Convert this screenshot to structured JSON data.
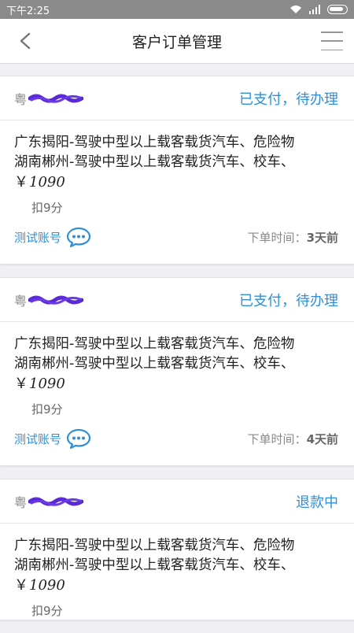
{
  "status_bar": {
    "time": "下午2:25"
  },
  "nav": {
    "title": "客户订单管理"
  },
  "orders": [
    {
      "plate": "粤",
      "status": "已支付，待办理",
      "route_1": "广东揭阳-驾驶中型以上载客载货汽车、危险物",
      "route_2": "湖南郴州-驾驶中型以上载客载货汽车、校车、",
      "currency": "￥",
      "price": "1090",
      "points": "扣9分",
      "account": "测试账号",
      "time_label": "下单时间：",
      "time_value": "3天前"
    },
    {
      "plate": "粤",
      "status": "已支付，待办理",
      "route_1": "广东揭阳-驾驶中型以上载客载货汽车、危险物",
      "route_2": "湖南郴州-驾驶中型以上载客载货汽车、校车、",
      "currency": "￥",
      "price": "1090",
      "points": "扣9分",
      "account": "测试账号",
      "time_label": "下单时间：",
      "time_value": "4天前"
    },
    {
      "plate": "粤",
      "status": "退款中",
      "route_1": "广东揭阳-驾驶中型以上载客载货汽车、危险物",
      "route_2": "湖南郴州-驾驶中型以上载客载货汽车、校车、",
      "currency": "￥",
      "price": "1090",
      "points": "扣9分"
    }
  ],
  "colors": {
    "accent": "#2f8fd8",
    "redaction": "#5a2ad6"
  },
  "icons": {
    "back": "chevron-left-icon",
    "menu": "hamburger-menu-icon",
    "chat": "chat-bubble-icon"
  }
}
